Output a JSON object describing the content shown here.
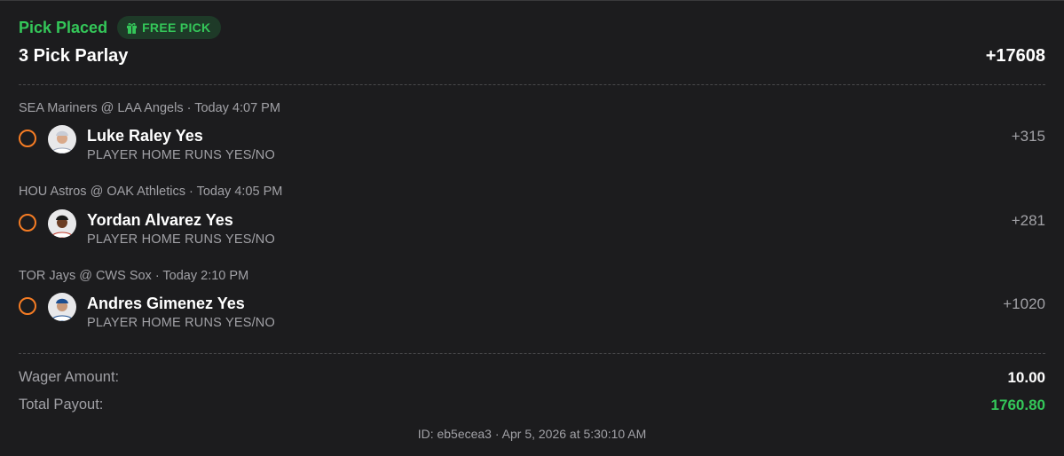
{
  "status": "Pick Placed",
  "badge": {
    "label": "FREE PICK",
    "icon": "gift-icon"
  },
  "title": "3 Pick Parlay",
  "total_odds": "+17608",
  "picks": [
    {
      "matchup": "SEA Mariners @ LAA Angels · Today 4:07 PM",
      "player": "Luke Raley Yes",
      "market": "PLAYER HOME RUNS YES/NO",
      "odds": "+315"
    },
    {
      "matchup": "HOU Astros @ OAK Athletics · Today 4:05 PM",
      "player": "Yordan Alvarez Yes",
      "market": "PLAYER HOME RUNS YES/NO",
      "odds": "+281"
    },
    {
      "matchup": "TOR Jays @ CWS Sox · Today 2:10 PM",
      "player": "Andres Gimenez Yes",
      "market": "PLAYER HOME RUNS YES/NO",
      "odds": "+1020"
    }
  ],
  "summary": {
    "wager_label": "Wager Amount:",
    "wager_value": "10.00",
    "payout_label": "Total Payout:",
    "payout_value": "1760.80"
  },
  "footer": "ID: eb5ecea3 · Apr 5, 2026 at 5:30:10 AM",
  "colors": {
    "accent_green": "#34c759",
    "pending_orange": "#f57c24",
    "background": "#1c1c1e"
  }
}
